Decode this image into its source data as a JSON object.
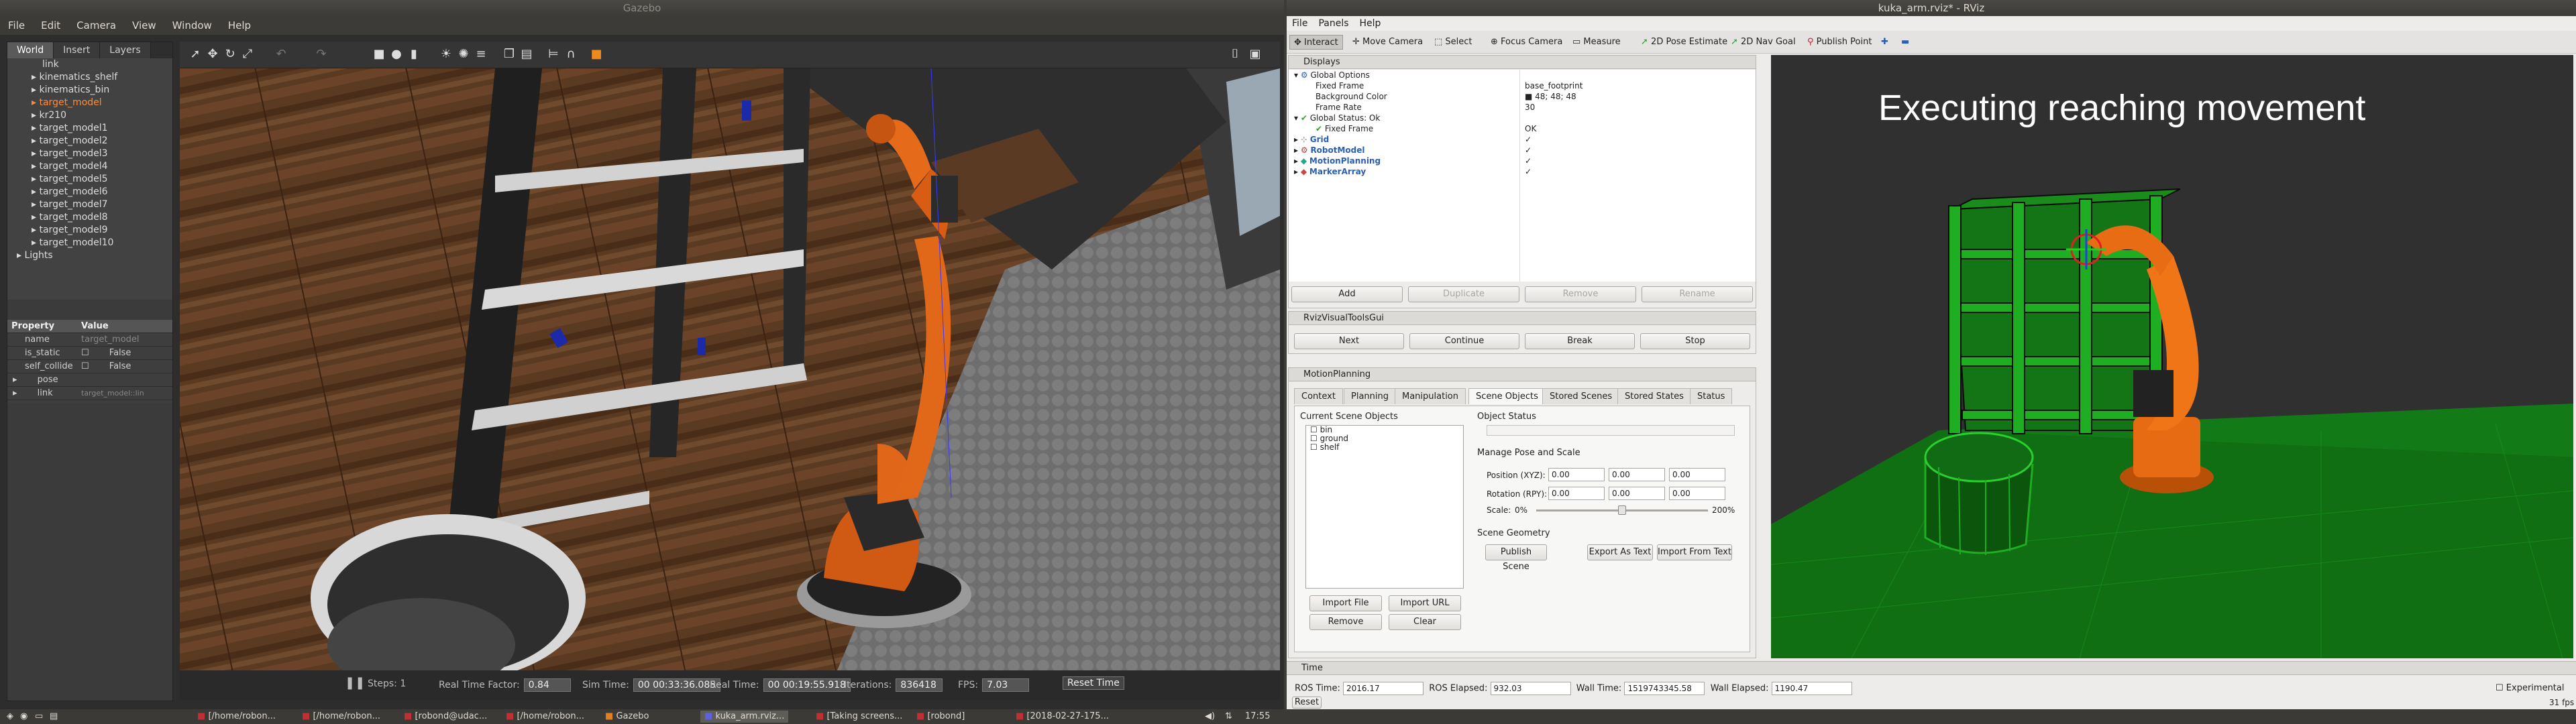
{
  "gazebo": {
    "title": "Gazebo",
    "menu": [
      "File",
      "Edit",
      "Camera",
      "View",
      "Window",
      "Help"
    ],
    "tabs": [
      "World",
      "Insert",
      "Layers"
    ],
    "tree": [
      "link",
      "kinematics_shelf",
      "kinematics_bin",
      "target_model",
      "kr210",
      "target_model1",
      "target_model2",
      "target_model3",
      "target_model4",
      "target_model5",
      "target_model6",
      "target_model7",
      "target_model8",
      "target_model9",
      "target_model10",
      "Lights"
    ],
    "props_header": {
      "property": "Property",
      "value": "Value"
    },
    "props": [
      {
        "k": "name",
        "v": "target_model"
      },
      {
        "k": "is_static",
        "v": "False"
      },
      {
        "k": "self_collide",
        "v": "False"
      },
      {
        "k": "pose",
        "v": ""
      },
      {
        "k": "link",
        "v": "target_model::lin"
      }
    ],
    "status": {
      "steps_label": "Steps:",
      "steps": "1",
      "rtf_label": "Real Time Factor:",
      "rtf": "0.84",
      "sim_label": "Sim Time:",
      "sim": "00 00:33:36.085",
      "real_label": "Real Time:",
      "real": "00 00:19:55.918",
      "iter_label": "Iterations:",
      "iter": "836418",
      "fps_label": "FPS:",
      "fps": "7.03",
      "reset": "Reset Time"
    }
  },
  "rviz": {
    "title": "kuka_arm.rviz* - RViz",
    "menu": [
      "File",
      "Panels",
      "Help"
    ],
    "toolbar": [
      "Interact",
      "Move Camera",
      "Select",
      "Focus Camera",
      "Measure",
      "2D Pose Estimate",
      "2D Nav Goal",
      "Publish Point"
    ],
    "displays": {
      "title": "Displays",
      "rows": [
        {
          "k": "Global Options",
          "v": ""
        },
        {
          "k": "Fixed Frame",
          "v": "base_footprint"
        },
        {
          "k": "Background Color",
          "v": "48; 48; 48"
        },
        {
          "k": "Frame Rate",
          "v": "30"
        },
        {
          "k": "Global Status: Ok",
          "v": ""
        },
        {
          "k": "Fixed Frame",
          "v": "OK"
        },
        {
          "k": "Grid",
          "v": "✓"
        },
        {
          "k": "RobotModel",
          "v": "✓"
        },
        {
          "k": "MotionPlanning",
          "v": "✓"
        },
        {
          "k": "MarkerArray",
          "v": "✓"
        }
      ],
      "buttons": [
        "Add",
        "Duplicate",
        "Remove",
        "Rename"
      ]
    },
    "visual_tools": {
      "title": "RvizVisualToolsGui",
      "buttons": [
        "Next",
        "Continue",
        "Break",
        "Stop"
      ]
    },
    "motion": {
      "title": "MotionPlanning",
      "tabs": [
        "Context",
        "Planning",
        "Manipulation",
        "Scene Objects",
        "Stored Scenes",
        "Stored States",
        "Status"
      ],
      "current_label": "Current Scene Objects",
      "objects": [
        "bin",
        "ground",
        "shelf"
      ],
      "status_label": "Object Status",
      "pose_label": "Manage Pose and Scale",
      "position_label": "Position (XYZ):",
      "rotation_label": "Rotation (RPY):",
      "pos": [
        "0.00",
        "0.00",
        "0.00"
      ],
      "rot": [
        "0.00",
        "0.00",
        "0.00"
      ],
      "scale_label": "Scale:",
      "scale_min": "0%",
      "scale_max": "200%",
      "scale_value": 0.5,
      "geometry_label": "Scene Geometry",
      "publish": "Publish Scene",
      "export": "Export As Text",
      "import_text": "Import From Text",
      "import_file": "Import File",
      "import_url": "Import URL",
      "remove": "Remove",
      "clear": "Clear"
    },
    "overlay_text": "Executing  reaching  movement",
    "time": {
      "title": "Time",
      "ros_time_label": "ROS Time:",
      "ros_time": "2016.17",
      "ros_elapsed_label": "ROS Elapsed:",
      "ros_elapsed": "932.03",
      "wall_time_label": "Wall Time:",
      "wall_time": "1519743345.58",
      "wall_elapsed_label": "Wall Elapsed:",
      "wall_elapsed": "1190.47",
      "experimental": "Experimental",
      "reset": "Reset",
      "fps": "31 fps"
    }
  },
  "taskbar": {
    "items": [
      "[/home/robon...",
      "[/home/robon...",
      "[robond@udac...",
      "[/home/robon...",
      "Gazebo",
      "kuka_arm.rviz...",
      "[Taking screens...",
      "[robond]",
      "[2018-02-27-175..."
    ],
    "clock": "17:55"
  }
}
